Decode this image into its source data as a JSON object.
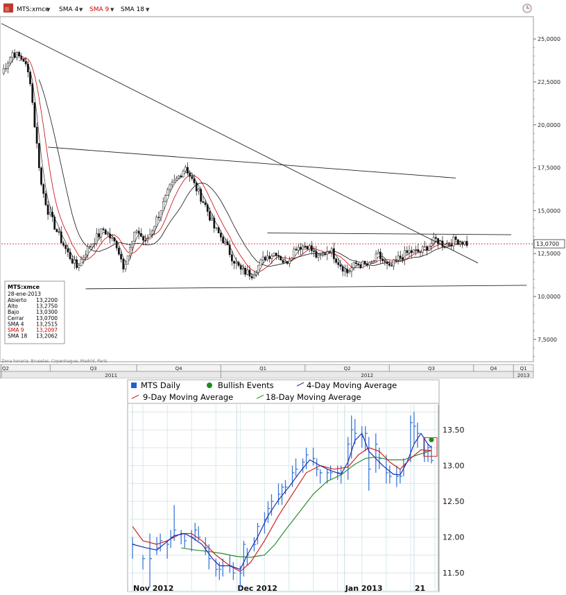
{
  "toolbar": {
    "items": [
      {
        "label": "MTS:xmce",
        "color": "#000000"
      },
      {
        "label": "SMA 4",
        "color": "#000000"
      },
      {
        "label": "SMA 9",
        "color": "#cc0000"
      },
      {
        "label": "SMA 18",
        "color": "#000000"
      }
    ]
  },
  "info_box": {
    "title": "MTS:xmce",
    "date": "28-ene-2013",
    "rows": [
      {
        "label": "Abierto",
        "value": "13,2200",
        "color": "#000000"
      },
      {
        "label": "Alto",
        "value": "13,2750",
        "color": "#000000"
      },
      {
        "label": "Bajo",
        "value": "13,0300",
        "color": "#000000"
      },
      {
        "label": "Cerrar",
        "value": "13,0700",
        "color": "#000000"
      },
      {
        "label": "SMA 4",
        "value": "13,2515",
        "color": "#000000"
      },
      {
        "label": "SMA 9",
        "value": "13,2097",
        "color": "#cc0000"
      },
      {
        "label": "SMA 18",
        "value": "13,2062",
        "color": "#000000"
      }
    ]
  },
  "timezone_note": "Zona horaria: Bruselas, Copenhague, Madrid, París",
  "current_price_label": "13,0700",
  "chart_data": [
    {
      "type": "candlestick",
      "ticker": "MTS:xmce",
      "y_ticks": [
        "25,0000",
        "22,5000",
        "20,0000",
        "17,5000",
        "15,0000",
        "12,5000",
        "10,0000",
        "7,5000"
      ],
      "y_tick_values": [
        25,
        22.5,
        20,
        17.5,
        15,
        12.5,
        10,
        7.5
      ],
      "ylim": [
        6.2,
        26.3
      ],
      "quarters": [
        "Q2",
        "Q3",
        "Q4",
        "Q1",
        "Q2",
        "Q3",
        "Q4",
        "Q1"
      ],
      "years": [
        "2011",
        "2012",
        "2013"
      ],
      "price_path": [
        [
          0,
          23.0
        ],
        [
          5,
          24.2
        ],
        [
          10,
          23.8
        ],
        [
          13,
          22.6
        ],
        [
          15,
          20.0
        ],
        [
          18,
          16.5
        ],
        [
          21,
          15.0
        ],
        [
          25,
          13.8
        ],
        [
          30,
          12.5
        ],
        [
          34,
          11.7
        ],
        [
          38,
          12.6
        ],
        [
          42,
          13.3
        ],
        [
          46,
          13.9
        ],
        [
          52,
          13.0
        ],
        [
          55,
          11.8
        ],
        [
          57,
          12.4
        ],
        [
          61,
          13.9
        ],
        [
          65,
          13.1
        ],
        [
          70,
          14.5
        ],
        [
          76,
          16.3
        ],
        [
          80,
          17.0
        ],
        [
          83,
          17.6
        ],
        [
          87,
          16.5
        ],
        [
          92,
          15.3
        ],
        [
          96,
          14.0
        ],
        [
          100,
          13.3
        ],
        [
          104,
          12.3
        ],
        [
          108,
          11.5
        ],
        [
          113,
          11.3
        ],
        [
          119,
          12.3
        ],
        [
          124,
          12.6
        ],
        [
          128,
          11.9
        ],
        [
          133,
          12.9
        ],
        [
          138,
          13.0
        ],
        [
          143,
          12.2
        ],
        [
          148,
          12.8
        ],
        [
          152,
          12.0
        ],
        [
          156,
          11.4
        ],
        [
          160,
          11.9
        ],
        [
          166,
          11.8
        ],
        [
          170,
          12.4
        ],
        [
          175,
          11.6
        ],
        [
          179,
          12.2
        ],
        [
          184,
          12.6
        ],
        [
          189,
          12.6
        ],
        [
          196,
          13.3
        ],
        [
          200,
          13.0
        ],
        [
          205,
          13.3
        ],
        [
          210,
          13.1
        ]
      ],
      "trendlines": [
        {
          "name": "long-downtrend",
          "from": [
            0,
            25.9
          ],
          "to": [
            215,
            11.95
          ]
        },
        {
          "name": "upper-diagonal",
          "from": [
            21,
            18.7
          ],
          "to": [
            205,
            16.9
          ]
        },
        {
          "name": "horizontal-resistance",
          "from": [
            120,
            13.7
          ],
          "to": [
            230,
            13.6
          ]
        },
        {
          "name": "support",
          "from": [
            38,
            10.45
          ],
          "to": [
            237,
            10.65
          ]
        }
      ],
      "current_value": 13.07
    },
    {
      "type": "line",
      "x_labels": [
        "Nov 2012",
        "Dec 2012",
        "Jan 2013",
        "21"
      ],
      "x_label_days": [
        0,
        30,
        61,
        81
      ],
      "y_ticks": [
        "13.50",
        "13.00",
        "12.50",
        "12.00",
        "11.50"
      ],
      "y_tick_values": [
        13.5,
        13.0,
        12.5,
        12.0,
        11.5
      ],
      "ylim": [
        11.25,
        13.85
      ],
      "legend": [
        "MTS Daily",
        "Bullish Events",
        "4-Day Moving Average",
        "9-Day Moving Average",
        "18-Day Moving Average"
      ],
      "legend_colors": [
        "#1f5fd8",
        "#1c8c1c",
        "#1a2fb0",
        "#cc2222",
        "#2e8b2e"
      ],
      "daily_bars": [
        [
          0,
          12.0,
          11.7,
          11.9
        ],
        [
          3,
          11.75,
          11.55,
          11.7
        ],
        [
          5,
          12.05,
          11.3,
          11.7
        ],
        [
          7,
          12.0,
          11.75,
          11.85
        ],
        [
          8,
          12.05,
          11.8,
          11.95
        ],
        [
          10,
          11.95,
          11.7,
          11.9
        ],
        [
          11,
          12.1,
          11.85,
          12.0
        ],
        [
          12,
          12.45,
          11.95,
          12.1
        ],
        [
          14,
          12.1,
          11.9,
          12.05
        ],
        [
          15,
          12.05,
          11.85,
          11.95
        ],
        [
          17,
          12.1,
          11.8,
          12.0
        ],
        [
          18,
          12.2,
          11.95,
          12.1
        ],
        [
          19,
          12.15,
          11.95,
          12.0
        ],
        [
          21,
          12.0,
          11.75,
          11.85
        ],
        [
          22,
          11.9,
          11.55,
          11.7
        ],
        [
          24,
          11.7,
          11.45,
          11.55
        ],
        [
          25,
          11.65,
          11.4,
          11.55
        ],
        [
          26,
          11.7,
          11.45,
          11.6
        ],
        [
          28,
          11.75,
          11.5,
          11.6
        ],
        [
          29,
          11.65,
          11.4,
          11.5
        ],
        [
          31,
          11.6,
          11.3,
          11.5
        ],
        [
          32,
          11.95,
          11.45,
          11.9
        ],
        [
          33,
          11.85,
          11.6,
          11.75
        ],
        [
          35,
          12.0,
          11.8,
          11.9
        ],
        [
          36,
          12.2,
          11.9,
          12.15
        ],
        [
          38,
          12.35,
          12.05,
          12.25
        ],
        [
          39,
          12.5,
          12.2,
          12.4
        ],
        [
          40,
          12.6,
          12.3,
          12.5
        ],
        [
          42,
          12.75,
          12.45,
          12.6
        ],
        [
          43,
          12.75,
          12.45,
          12.7
        ],
        [
          44,
          12.8,
          12.6,
          12.7
        ],
        [
          46,
          13.0,
          12.7,
          12.9
        ],
        [
          47,
          13.1,
          12.85,
          12.95
        ],
        [
          49,
          13.1,
          12.9,
          13.05
        ],
        [
          50,
          13.25,
          12.95,
          13.15
        ],
        [
          52,
          13.25,
          13.0,
          13.1
        ],
        [
          53,
          13.1,
          12.85,
          12.95
        ],
        [
          54,
          12.95,
          12.75,
          12.9
        ],
        [
          56,
          12.95,
          12.75,
          12.9
        ],
        [
          57,
          13.0,
          12.8,
          12.9
        ],
        [
          59,
          13.0,
          12.8,
          12.9
        ],
        [
          60,
          13.0,
          12.75,
          12.9
        ],
        [
          62,
          13.4,
          12.8,
          13.3
        ],
        [
          63,
          13.7,
          13.1,
          13.5
        ],
        [
          64,
          13.65,
          13.3,
          13.45
        ],
        [
          66,
          13.55,
          13.25,
          13.4
        ],
        [
          67,
          13.55,
          13.2,
          13.45
        ],
        [
          68,
          13.4,
          12.65,
          12.95
        ],
        [
          70,
          13.45,
          12.9,
          13.3
        ],
        [
          71,
          13.25,
          12.95,
          13.1
        ],
        [
          73,
          13.15,
          12.75,
          12.9
        ],
        [
          74,
          13.0,
          12.75,
          12.85
        ],
        [
          76,
          13.0,
          12.7,
          12.85
        ],
        [
          77,
          12.95,
          12.75,
          12.85
        ],
        [
          78,
          13.1,
          12.85,
          13.0
        ],
        [
          80,
          13.7,
          13.05,
          13.6
        ],
        [
          81,
          13.75,
          13.3,
          13.55
        ],
        [
          82,
          13.6,
          13.25,
          13.45
        ],
        [
          84,
          13.4,
          13.05,
          13.2
        ],
        [
          85,
          13.3,
          13.05,
          13.25
        ],
        [
          86,
          13.28,
          13.03,
          13.07
        ]
      ],
      "sma4": [
        [
          0,
          11.9
        ],
        [
          4,
          11.85
        ],
        [
          7,
          11.82
        ],
        [
          9,
          11.9
        ],
        [
          12,
          12.02
        ],
        [
          15,
          12.05
        ],
        [
          17,
          12.0
        ],
        [
          20,
          11.9
        ],
        [
          23,
          11.7
        ],
        [
          25,
          11.6
        ],
        [
          28,
          11.6
        ],
        [
          31,
          11.55
        ],
        [
          33,
          11.75
        ],
        [
          36,
          12.0
        ],
        [
          39,
          12.3
        ],
        [
          42,
          12.52
        ],
        [
          45,
          12.7
        ],
        [
          48,
          12.9
        ],
        [
          51,
          13.08
        ],
        [
          54,
          13.0
        ],
        [
          57,
          12.93
        ],
        [
          60,
          12.88
        ],
        [
          62,
          13.05
        ],
        [
          64,
          13.35
        ],
        [
          66,
          13.45
        ],
        [
          68,
          13.2
        ],
        [
          70,
          13.1
        ],
        [
          72,
          13.0
        ],
        [
          75,
          12.88
        ],
        [
          77,
          12.87
        ],
        [
          79,
          13.05
        ],
        [
          81,
          13.3
        ],
        [
          83,
          13.45
        ],
        [
          85,
          13.3
        ],
        [
          86,
          13.25
        ]
      ],
      "sma9": [
        [
          0,
          12.15
        ],
        [
          3,
          11.95
        ],
        [
          7,
          11.9
        ],
        [
          10,
          11.95
        ],
        [
          14,
          12.05
        ],
        [
          17,
          12.05
        ],
        [
          20,
          11.95
        ],
        [
          24,
          11.75
        ],
        [
          28,
          11.6
        ],
        [
          31,
          11.52
        ],
        [
          34,
          11.65
        ],
        [
          38,
          11.95
        ],
        [
          42,
          12.3
        ],
        [
          46,
          12.6
        ],
        [
          50,
          12.9
        ],
        [
          54,
          13.0
        ],
        [
          58,
          12.95
        ],
        [
          62,
          12.98
        ],
        [
          65,
          13.15
        ],
        [
          68,
          13.25
        ],
        [
          71,
          13.2
        ],
        [
          74,
          13.05
        ],
        [
          77,
          12.95
        ],
        [
          80,
          13.1
        ],
        [
          83,
          13.22
        ],
        [
          86,
          13.21
        ]
      ],
      "sma18": [
        [
          14,
          11.85
        ],
        [
          18,
          11.82
        ],
        [
          22,
          11.8
        ],
        [
          26,
          11.77
        ],
        [
          30,
          11.73
        ],
        [
          34,
          11.72
        ],
        [
          38,
          11.75
        ],
        [
          41,
          11.9
        ],
        [
          44,
          12.1
        ],
        [
          48,
          12.35
        ],
        [
          52,
          12.6
        ],
        [
          56,
          12.78
        ],
        [
          60,
          12.87
        ],
        [
          64,
          13.02
        ],
        [
          67,
          13.1
        ],
        [
          70,
          13.12
        ],
        [
          74,
          13.08
        ],
        [
          78,
          13.08
        ],
        [
          82,
          13.15
        ],
        [
          86,
          13.21
        ]
      ],
      "bullish_events": [
        [
          86,
          13.36
        ]
      ]
    }
  ]
}
